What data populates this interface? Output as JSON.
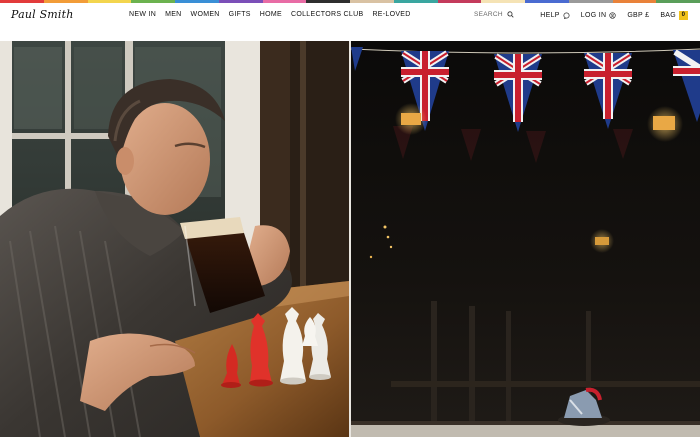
{
  "brand": {
    "logo_text": "Paul Smith"
  },
  "nav": {
    "items": [
      {
        "label": "NEW IN"
      },
      {
        "label": "MEN"
      },
      {
        "label": "WOMEN"
      },
      {
        "label": "GIFTS"
      },
      {
        "label": "HOME"
      },
      {
        "label": "COLLECTORS CLUB"
      },
      {
        "label": "RE-LOVED"
      }
    ]
  },
  "search": {
    "label": "SEARCH",
    "icon": "search-icon"
  },
  "utility": {
    "help": {
      "label": "HELP",
      "icon": "chat-icon"
    },
    "login": {
      "label": "LOG IN",
      "icon": "user-icon"
    },
    "currency": {
      "label": "GBP £"
    },
    "bag": {
      "label": "BAG",
      "count": "0"
    }
  },
  "stripe_colors": [
    "#e23b3b",
    "#f29c38",
    "#f3d54e",
    "#6cb24f",
    "#3a8fd6",
    "#7b4fb8",
    "#e86ca5",
    "#2f2f2f",
    "#d9c2a3",
    "#3aa6a0",
    "#c43b5c",
    "#f5e3b5",
    "#4a6bd1",
    "#9a9a9a",
    "#e9823a",
    "#5a9e5a"
  ],
  "hero": {
    "left_image": "man-drinking-pint-with-chess-pieces",
    "right_image": "dark-pub-interior-with-union-jack-bunting"
  }
}
